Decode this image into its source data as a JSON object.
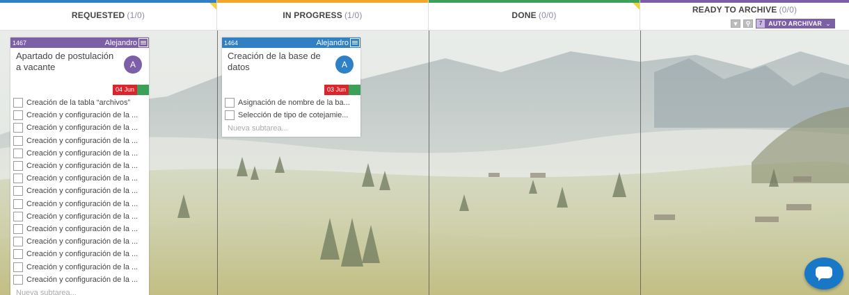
{
  "columns": [
    {
      "name": "REQUESTED",
      "count": "(1/0)",
      "color": "#2f80c4"
    },
    {
      "name": "IN PROGRESS",
      "count": "(1/0)",
      "color": "#f1a628"
    },
    {
      "name": "DONE",
      "count": "(0/0)",
      "color": "#3aa05a"
    },
    {
      "name": "READY TO ARCHIVE",
      "count": "(0/0)",
      "color": "#7c5fa6"
    }
  ],
  "archive_tools": {
    "auto_count": "7",
    "auto_label": "AUTO ARCHIVAR",
    "chevron": "chevron-down-icon"
  },
  "cards": [
    {
      "id": "1467",
      "owner": "Alejandro",
      "title": "Apartado de postulación a vacante",
      "avatar": "A",
      "head_color": "#7c5fa6",
      "avatar_color": "#7c5fa6",
      "due": "04 Jun",
      "subtasks": [
        "Creación de la tabla “archivos”",
        "Creación y configuración de la ...",
        "Creación y configuración de la ...",
        "Creación y configuración de la ...",
        "Creación y configuración de la ...",
        "Creación y configuración de la ...",
        "Creación y configuración de la ...",
        "Creación y configuración de la ...",
        "Creación y configuración de la ...",
        "Creación y configuración de la ...",
        "Creación y configuración de la ...",
        "Creación y configuración de la ...",
        "Creación y configuración de la ...",
        "Creación y configuración de la ...",
        "Creación y configuración de la ..."
      ],
      "new_subtask_placeholder": "Nueva subtarea..."
    },
    {
      "id": "1464",
      "owner": "Alejandro",
      "title": "Creación de la base de datos",
      "avatar": "A",
      "head_color": "#2f80c4",
      "avatar_color": "#2f80c4",
      "due": "03 Jun",
      "subtasks": [
        "Asignación de nombre de la ba...",
        "Selección de tipo de cotejamie..."
      ],
      "new_subtask_placeholder": "Nueva subtarea..."
    }
  ],
  "colors": {
    "due_red": "#d9252c",
    "flag_green": "#3aa05a",
    "chat_blue": "#1877c7"
  }
}
